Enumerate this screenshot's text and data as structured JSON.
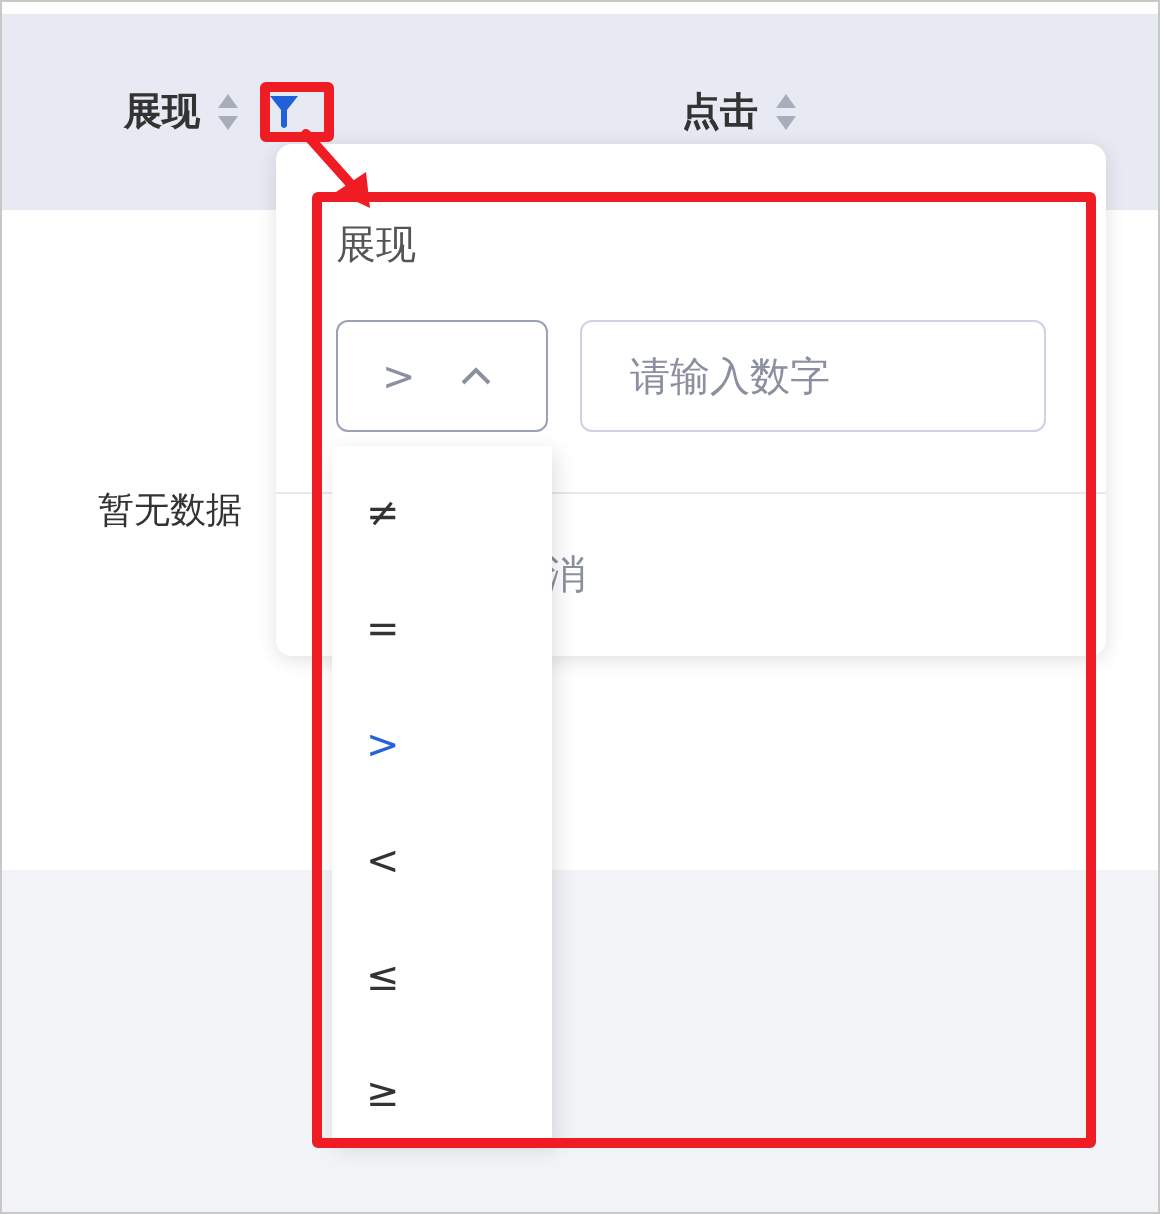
{
  "table": {
    "columns": [
      {
        "label": "展现",
        "filter_active": true
      },
      {
        "label": "点击"
      }
    ],
    "empty_text": "暂无数据"
  },
  "filter_popup": {
    "title": "展现",
    "operator": ">",
    "value_placeholder": "请输入数字",
    "footer_button": "消"
  },
  "operator_menu": {
    "options": [
      {
        "label": "≠",
        "selected": false
      },
      {
        "label": "=",
        "selected": false
      },
      {
        "label": ">",
        "selected": true
      },
      {
        "label": "<",
        "selected": false
      },
      {
        "label": "≤",
        "selected": false
      },
      {
        "label": "≥",
        "selected": false
      }
    ]
  },
  "annotations": [
    {
      "kind": "box"
    },
    {
      "kind": "box"
    },
    {
      "kind": "arrow"
    }
  ]
}
